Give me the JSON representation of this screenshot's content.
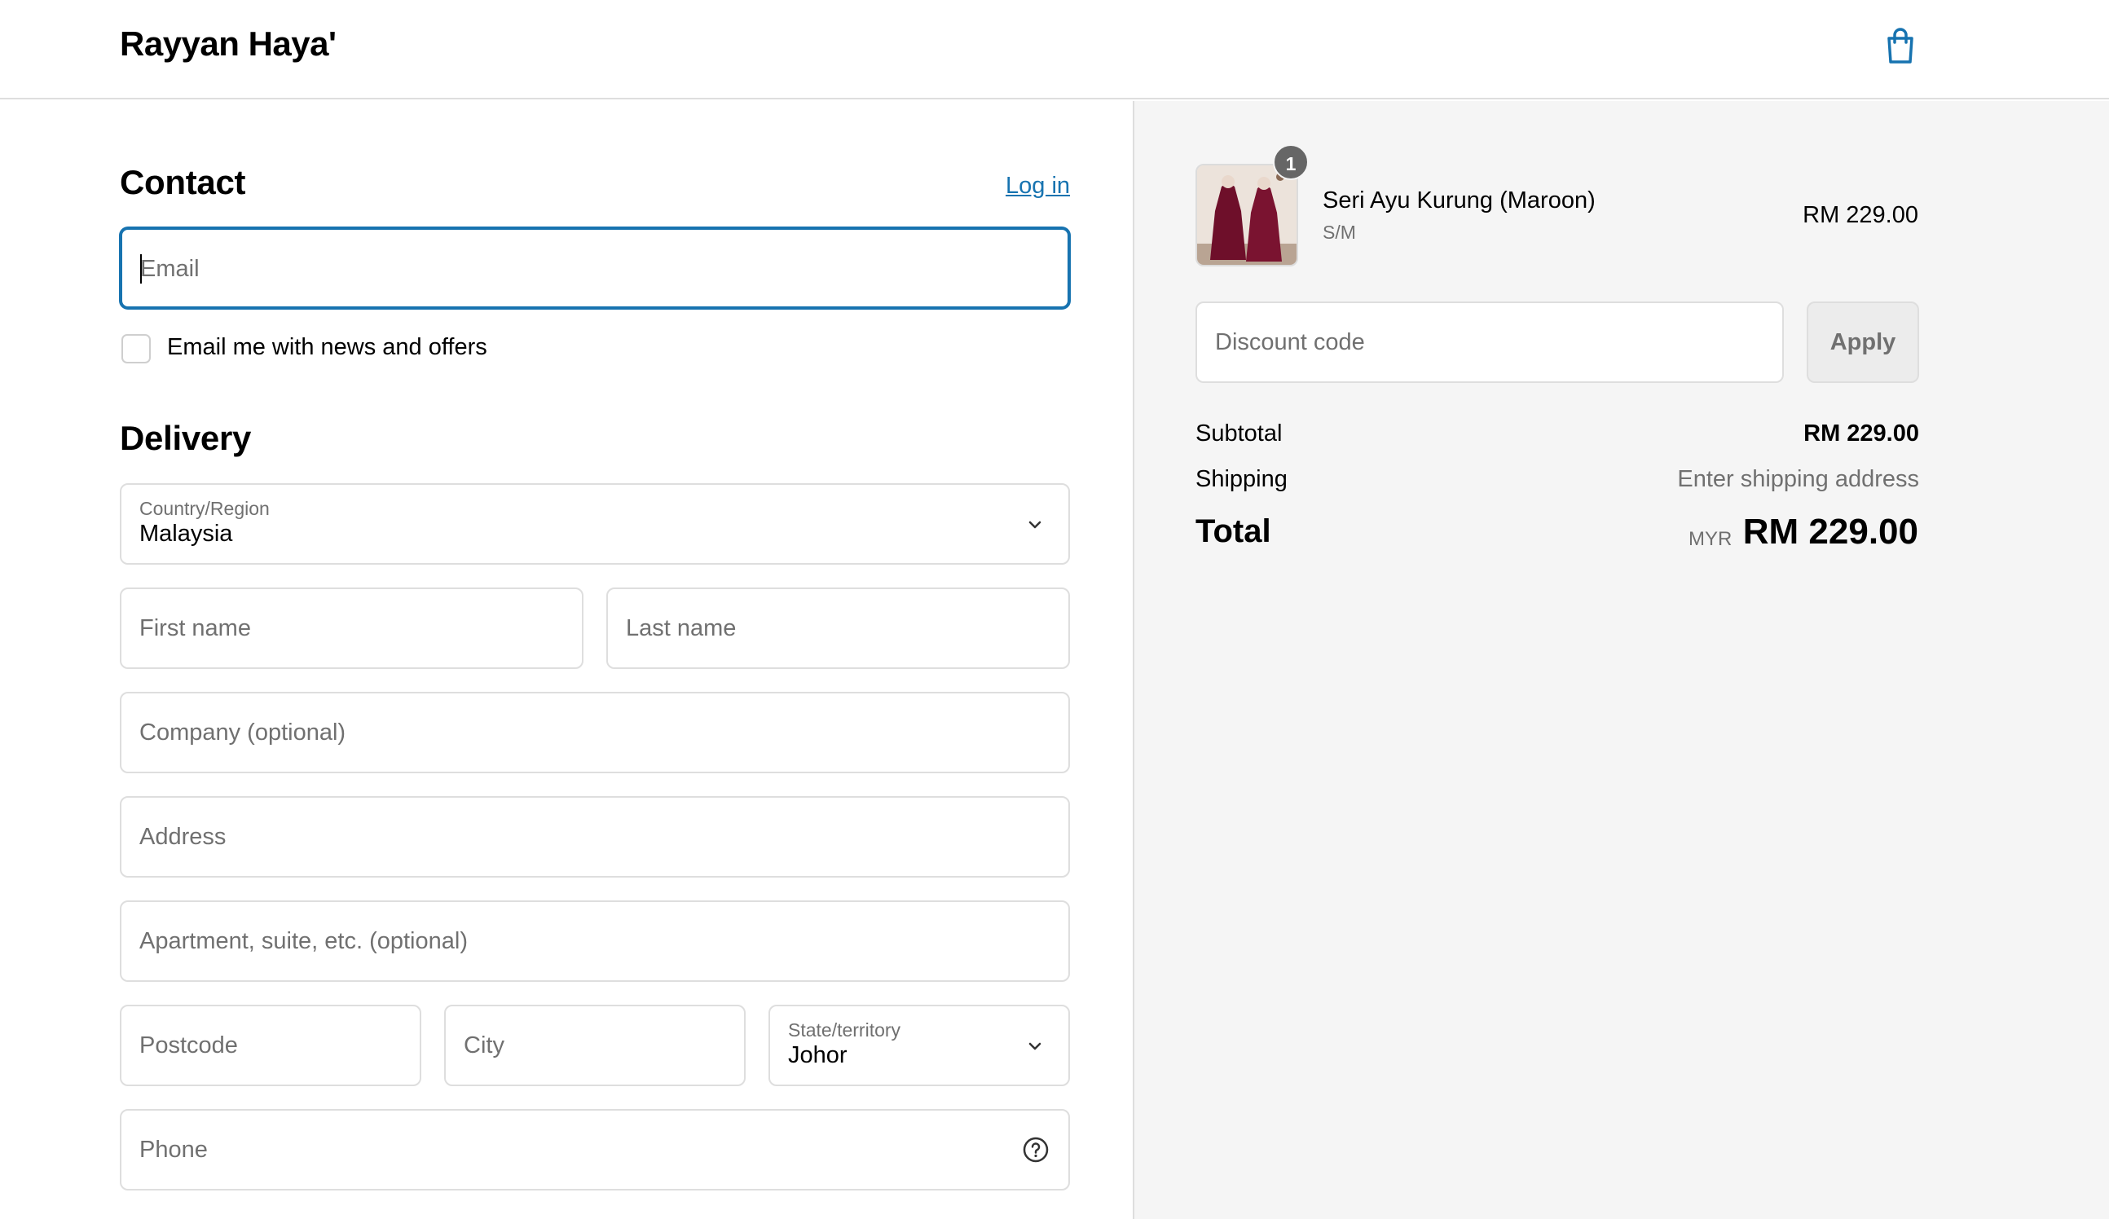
{
  "header": {
    "store_name": "Rayyan Haya'",
    "cart_icon": "shopping-bag-icon"
  },
  "contact": {
    "title": "Contact",
    "login_link": "Log in",
    "email_placeholder": "Email",
    "newsletter_label": "Email me with news and offers"
  },
  "delivery": {
    "title": "Delivery",
    "country_caption": "Country/Region",
    "country_value": "Malaysia",
    "first_name_placeholder": "First name",
    "last_name_placeholder": "Last name",
    "company_placeholder": "Company (optional)",
    "address_placeholder": "Address",
    "apartment_placeholder": "Apartment, suite, etc. (optional)",
    "postcode_placeholder": "Postcode",
    "city_placeholder": "City",
    "state_caption": "State/territory",
    "state_value": "Johor",
    "phone_placeholder": "Phone",
    "help_icon": "question-circle-icon"
  },
  "order": {
    "item": {
      "quantity": "1",
      "name": "Seri Ayu Kurung (Maroon)",
      "variant": "S/M",
      "price": "RM 229.00",
      "image_icon": "product-thumbnail"
    },
    "discount_placeholder": "Discount code",
    "apply_label": "Apply",
    "subtotal_label": "Subtotal",
    "subtotal_value": "RM 229.00",
    "shipping_label": "Shipping",
    "shipping_value": "Enter shipping address",
    "total_label": "Total",
    "total_currency": "MYR",
    "total_value": "RM 229.00"
  },
  "colors": {
    "accent": "#1773b0",
    "summary_bg": "#f5f5f5",
    "border": "#dedede"
  }
}
